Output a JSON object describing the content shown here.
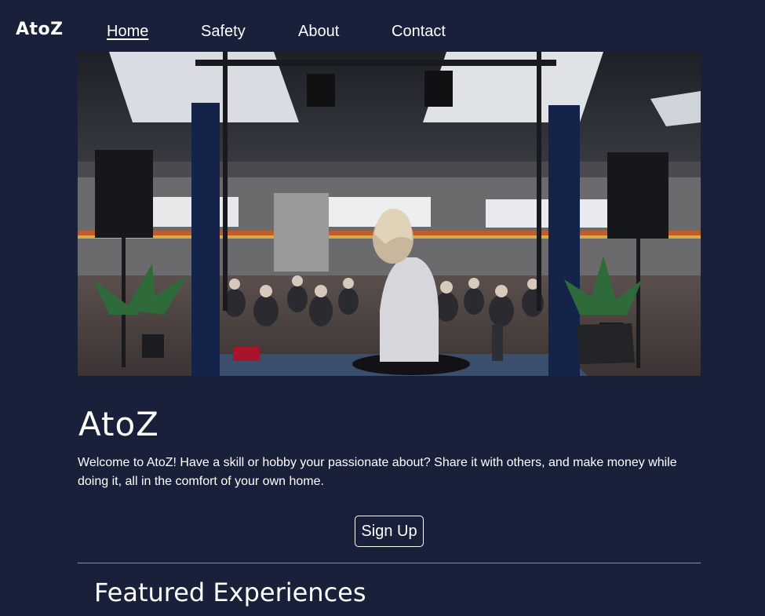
{
  "nav": {
    "brand": "AtoZ",
    "links": [
      {
        "label": "Home",
        "active": true
      },
      {
        "label": "Safety",
        "active": false
      },
      {
        "label": "About",
        "active": false
      },
      {
        "label": "Contact",
        "active": false
      }
    ]
  },
  "hero": {
    "image_icon": "workshop-photo",
    "title": "AtoZ",
    "welcome_text": "Welcome to AtoZ! Have a skill or hobby your passionate about? Share it with others, and make money while doing it, all in the comfort of your own home.",
    "signup_label": "Sign Up"
  },
  "featured": {
    "title": "Featured Experiences"
  },
  "colors": {
    "background": "#18203a",
    "text": "#ffffff",
    "divider": "#8a90a3"
  }
}
